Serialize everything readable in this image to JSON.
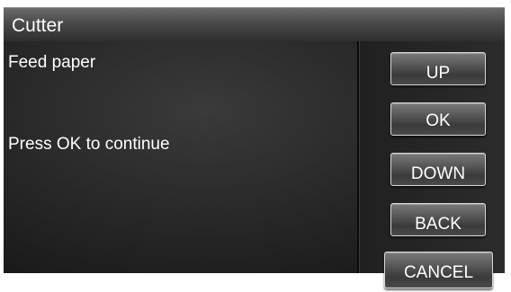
{
  "header": {
    "title": "Cutter"
  },
  "message": {
    "line1": "Feed paper",
    "line2": "Press OK to continue"
  },
  "buttons": {
    "up": "UP",
    "ok": "OK",
    "down": "DOWN",
    "back": "BACK",
    "cancel": "CANCEL"
  },
  "colors": {
    "title_bar": "#4a4a4a",
    "background": "#252525",
    "text": "#ffffff",
    "button_border": "#d8d8d8"
  }
}
